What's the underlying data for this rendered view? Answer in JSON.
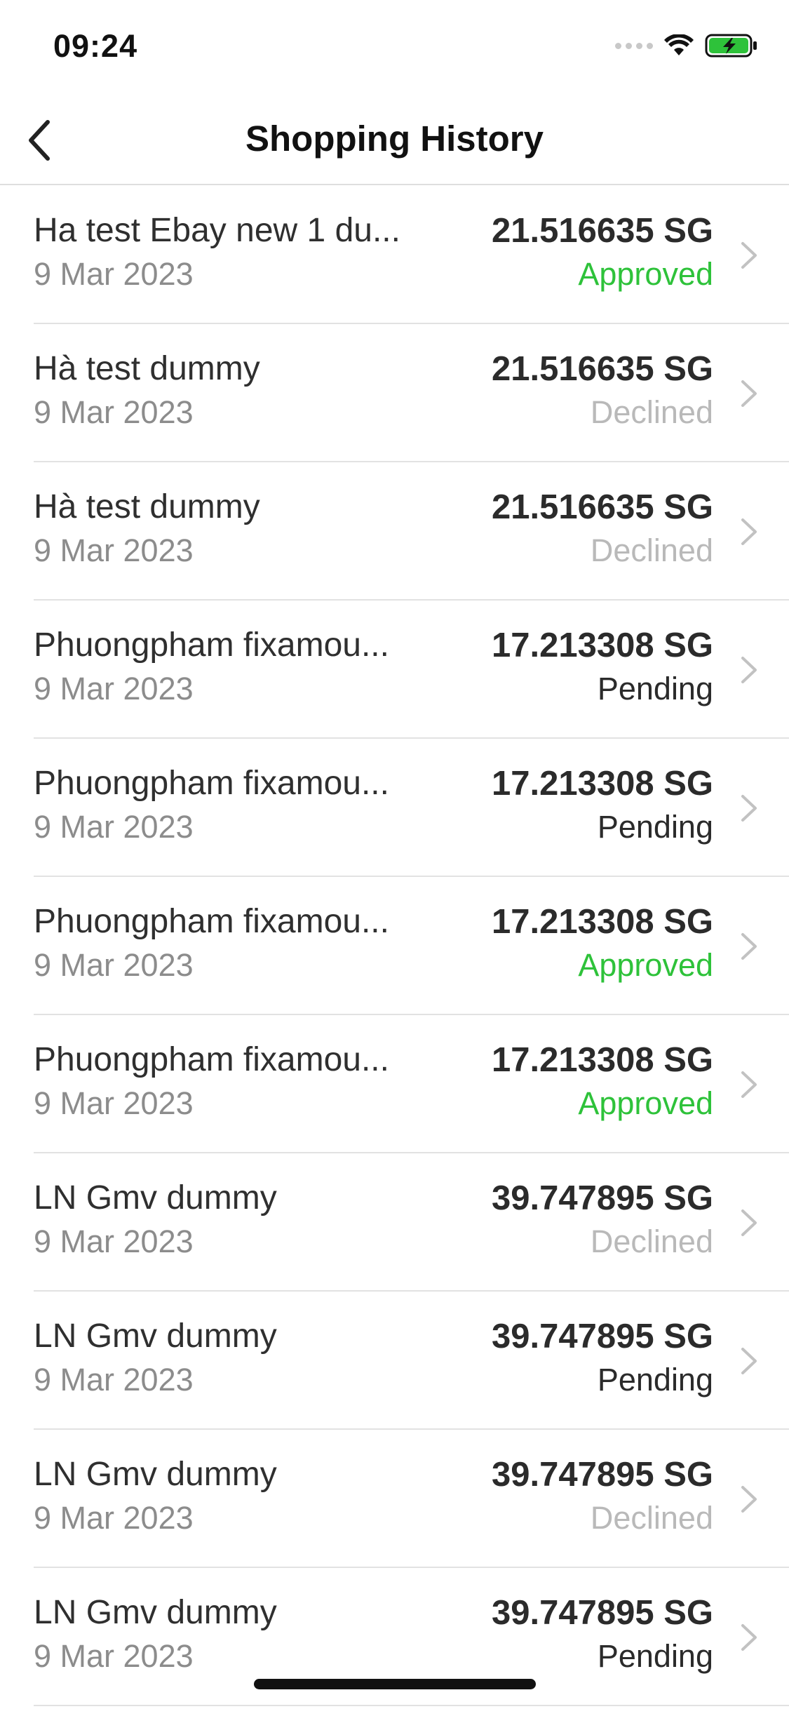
{
  "status_bar": {
    "time": "09:24",
    "icons": [
      "cellular-signal-icon",
      "wifi-icon",
      "battery-charging-icon"
    ],
    "battery_color": "#2ec23a"
  },
  "nav": {
    "title": "Shopping History",
    "back_icon": "chevron-left-icon"
  },
  "colors": {
    "approved": "#2ec23a",
    "declined": "#b9b9b9",
    "pending": "#2b2b2b"
  },
  "transactions": [
    {
      "name": "Ha test Ebay new 1 du...",
      "date": "9 Mar 2023",
      "amount": "21.516635 SG",
      "status": "Approved"
    },
    {
      "name": "Hà test dummy",
      "date": "9 Mar 2023",
      "amount": "21.516635 SG",
      "status": "Declined"
    },
    {
      "name": "Hà test dummy",
      "date": "9 Mar 2023",
      "amount": "21.516635 SG",
      "status": "Declined"
    },
    {
      "name": "Phuongpham fixamou...",
      "date": "9 Mar 2023",
      "amount": "17.213308 SG",
      "status": "Pending"
    },
    {
      "name": "Phuongpham fixamou...",
      "date": "9 Mar 2023",
      "amount": "17.213308 SG",
      "status": "Pending"
    },
    {
      "name": "Phuongpham fixamou...",
      "date": "9 Mar 2023",
      "amount": "17.213308 SG",
      "status": "Approved"
    },
    {
      "name": "Phuongpham fixamou...",
      "date": "9 Mar 2023",
      "amount": "17.213308 SG",
      "status": "Approved"
    },
    {
      "name": "LN Gmv dummy",
      "date": "9 Mar 2023",
      "amount": "39.747895 SG",
      "status": "Declined"
    },
    {
      "name": "LN Gmv dummy",
      "date": "9 Mar 2023",
      "amount": "39.747895 SG",
      "status": "Pending"
    },
    {
      "name": "LN Gmv dummy",
      "date": "9 Mar 2023",
      "amount": "39.747895 SG",
      "status": "Declined"
    },
    {
      "name": "LN Gmv dummy",
      "date": "9 Mar 2023",
      "amount": "39.747895 SG",
      "status": "Pending"
    }
  ]
}
